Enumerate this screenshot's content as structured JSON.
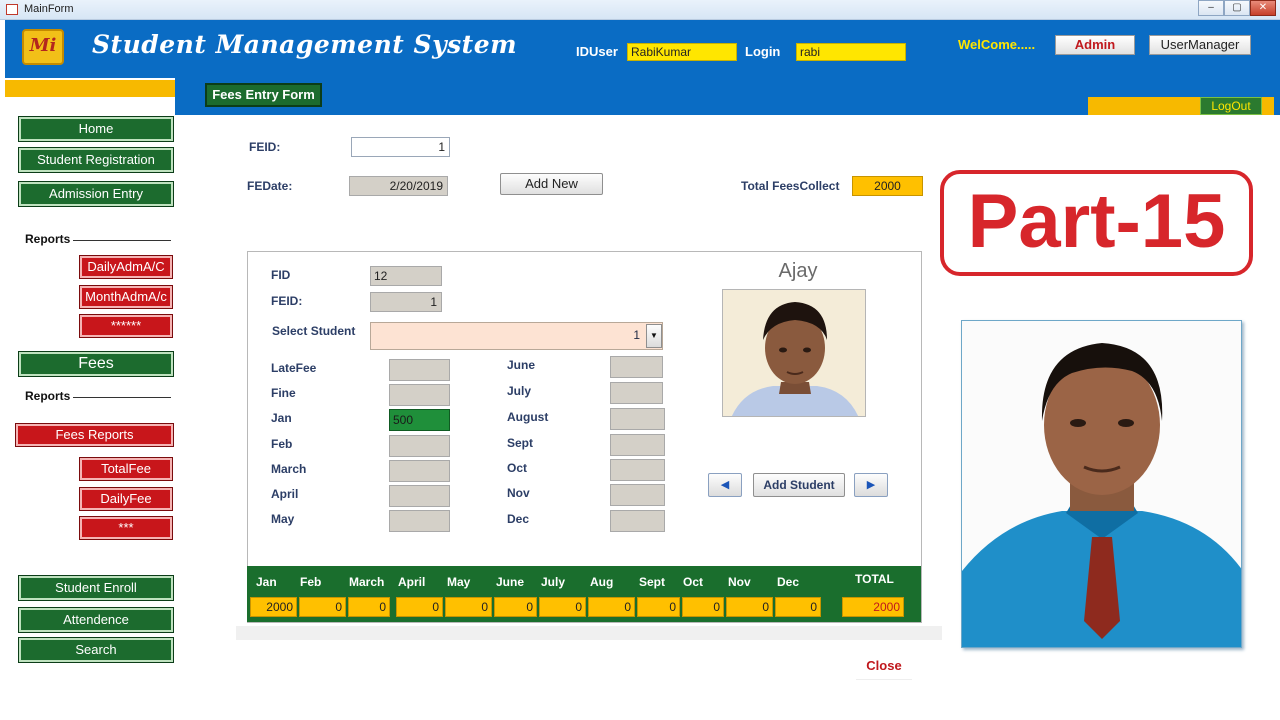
{
  "window": {
    "title": "MainForm",
    "controls": [
      "–",
      "▢",
      "✕"
    ]
  },
  "header": {
    "logo_text": "Mi",
    "app_title": "Student Management System",
    "iduser_label": "IDUser",
    "iduser_value": "RabiKumar",
    "login_label": "Login",
    "login_value": "rabi",
    "welcome": "WelCome.....",
    "admin_button": "Admin",
    "usermanager_button": "UserManager",
    "logout": "LogOut"
  },
  "form_tab": "Fees Entry Form",
  "sidebar": {
    "home": "Home",
    "student_registration": "Student Registration",
    "admission_entry": "Admission Entry",
    "reports_label_1": "Reports",
    "daily_adm": "DailyAdmA/C",
    "month_adm": "MonthAdmA/c",
    "stars6": "******",
    "fees": "Fees",
    "reports_label_2": "Reports",
    "fees_reports": "Fees Reports",
    "total_fee": "TotalFee",
    "daily_fee": "DailyFee",
    "stars3": "***",
    "student_enroll": "Student  Enroll",
    "attendence": "Attendence",
    "search": "Search"
  },
  "entry": {
    "feid_label": "FEID:",
    "feid_value": "1",
    "fedate_label": "FEDate:",
    "fedate_value": "2/20/2019",
    "add_new": "Add New",
    "total_label": "Total FeesCollect",
    "total_value": "2000"
  },
  "panel": {
    "fid_label": "FID",
    "fid_value": "12",
    "feid_label": "FEID:",
    "feid_value": "1",
    "select_label": "Select Student",
    "select_value": "1",
    "student_name": "Ajay",
    "add_student": "Add Student",
    "left_fields": [
      {
        "label": "LateFee",
        "value": ""
      },
      {
        "label": "Fine",
        "value": ""
      },
      {
        "label": "Jan",
        "value": "500"
      },
      {
        "label": "Feb",
        "value": ""
      },
      {
        "label": "March",
        "value": ""
      },
      {
        "label": "April",
        "value": ""
      },
      {
        "label": "May",
        "value": ""
      }
    ],
    "right_fields": [
      {
        "label": "June",
        "value": ""
      },
      {
        "label": "July",
        "value": ""
      },
      {
        "label": "August",
        "value": ""
      },
      {
        "label": "Sept",
        "value": ""
      },
      {
        "label": "Oct",
        "value": ""
      },
      {
        "label": "Nov",
        "value": ""
      },
      {
        "label": "Dec",
        "value": ""
      }
    ]
  },
  "totals": {
    "headers": [
      "Jan",
      "Feb",
      "March",
      "April",
      "May",
      "June",
      "July",
      "Aug",
      "Sept",
      "Oct",
      "Nov",
      "Dec",
      "TOTAL"
    ],
    "values": [
      "2000",
      "0",
      "0",
      "0",
      "0",
      "0",
      "0",
      "0",
      "0",
      "0",
      "0",
      "0",
      "2000"
    ]
  },
  "close": "Close",
  "promo": "Part-15",
  "colors": {
    "header_blue": "#0a6cc4",
    "accent_yellow": "#ffc000",
    "green": "#1c6b2e",
    "red": "#c8161b"
  }
}
